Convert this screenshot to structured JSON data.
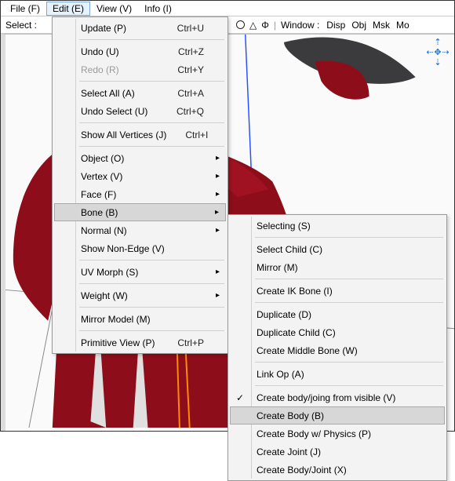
{
  "menubar": {
    "file": "File (F)",
    "edit": "Edit (E)",
    "view": "View (V)",
    "info": "Info (I)"
  },
  "toolbar": {
    "select": "Select :",
    "window_label": "Window :",
    "disp": "Disp",
    "obj": "Obj",
    "msk": "Msk",
    "mo": "Mo"
  },
  "edit_menu": {
    "update": "Update (P)",
    "update_sc": "Ctrl+U",
    "undo": "Undo (U)",
    "undo_sc": "Ctrl+Z",
    "redo": "Redo (R)",
    "redo_sc": "Ctrl+Y",
    "select_all": "Select All (A)",
    "select_all_sc": "Ctrl+A",
    "undo_select": "Undo Select (U)",
    "undo_select_sc": "Ctrl+Q",
    "show_all_vertices": "Show All Vertices (J)",
    "show_all_vertices_sc": "Ctrl+I",
    "object": "Object (O)",
    "vertex": "Vertex (V)",
    "face": "Face (F)",
    "bone": "Bone (B)",
    "normal": "Normal (N)",
    "show_non_edge": "Show Non-Edge (V)",
    "uv_morph": "UV Morph (S)",
    "weight": "Weight (W)",
    "mirror_model": "Mirror Model (M)",
    "primitive_view": "Primitive View (P)",
    "primitive_view_sc": "Ctrl+P"
  },
  "bone_menu": {
    "selecting": "Selecting (S)",
    "select_child": "Select Child (C)",
    "mirror": "Mirror (M)",
    "create_ik": "Create IK Bone (I)",
    "duplicate": "Duplicate (D)",
    "duplicate_child": "Duplicate Child (C)",
    "create_middle": "Create Middle Bone (W)",
    "link_op": "Link Op (A)",
    "create_from_visible": "Create body/joing from visible (V)",
    "create_body": "Create Body (B)",
    "create_body_physics": "Create Body w/ Physics (P)",
    "create_joint": "Create Joint (J)",
    "create_body_joint": "Create Body/Joint (X)"
  }
}
